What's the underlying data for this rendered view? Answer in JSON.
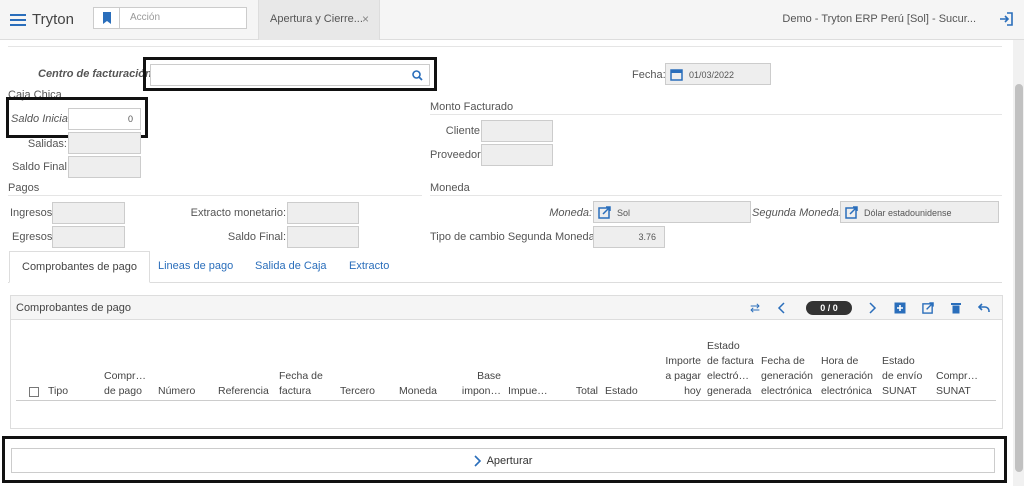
{
  "app": {
    "brand": "Tryton",
    "action_placeholder": "Acción",
    "tab_title": "Apertura y Cierre...",
    "tab_close": "×",
    "company": "Demo - Tryton ERP Perú [Sol] - Sucur..."
  },
  "form": {
    "centro_label": "Centro de facturación:",
    "centro_value": "",
    "fecha_label": "Fecha:",
    "fecha_value": "01/03/2022",
    "caja_chica": {
      "title": "Caja Chica",
      "saldo_inicial_label": "Saldo Inicial",
      "saldo_inicial_value": "0",
      "salidas_label": "Salidas:",
      "saldo_final_label": "Saldo Final"
    },
    "monto_facturado": {
      "title": "Monto Facturado",
      "cliente_label": "Cliente",
      "proveedor_label": "Proveedor"
    },
    "pagos": {
      "title": "Pagos",
      "ingresos_label": "Ingresos",
      "egresos_label": "Egresos",
      "extracto_label": "Extracto monetario:",
      "saldo_final_label": "Saldo Final:"
    },
    "moneda": {
      "title": "Moneda",
      "moneda_label": "Moneda:",
      "moneda_value": "Sol",
      "segunda_label": "Segunda Moneda:",
      "segunda_value": "Dólar estadounidense",
      "tipo_cambio_label": "Tipo de cambio Segunda Moneda:",
      "tipo_cambio_value": "3.76"
    }
  },
  "tabs": [
    "Comprobantes de pago",
    "Lineas de pago",
    "Salida de Caja",
    "Extracto"
  ],
  "panel": {
    "title": "Comprobantes de pago",
    "count": "0 / 0",
    "columns": [
      "Tipo",
      "Compr…\nde pago",
      "Número",
      "Referencia",
      "Fecha de\nfactura",
      "Tercero",
      "Moneda",
      "Base\nimpon…",
      "Impue…",
      "Total",
      "Estado",
      "Importe\na pagar\nhoy",
      "Estado\nde factura\nelectró…\ngenerada",
      "Fecha de\ngeneración\nelectrónica",
      "Hora de\ngeneración\nelectrónica",
      "Estado\nde envío\nSUNAT",
      "Compr…\nSUNAT"
    ]
  },
  "bottom": {
    "aperturar_label": "Aperturar"
  }
}
